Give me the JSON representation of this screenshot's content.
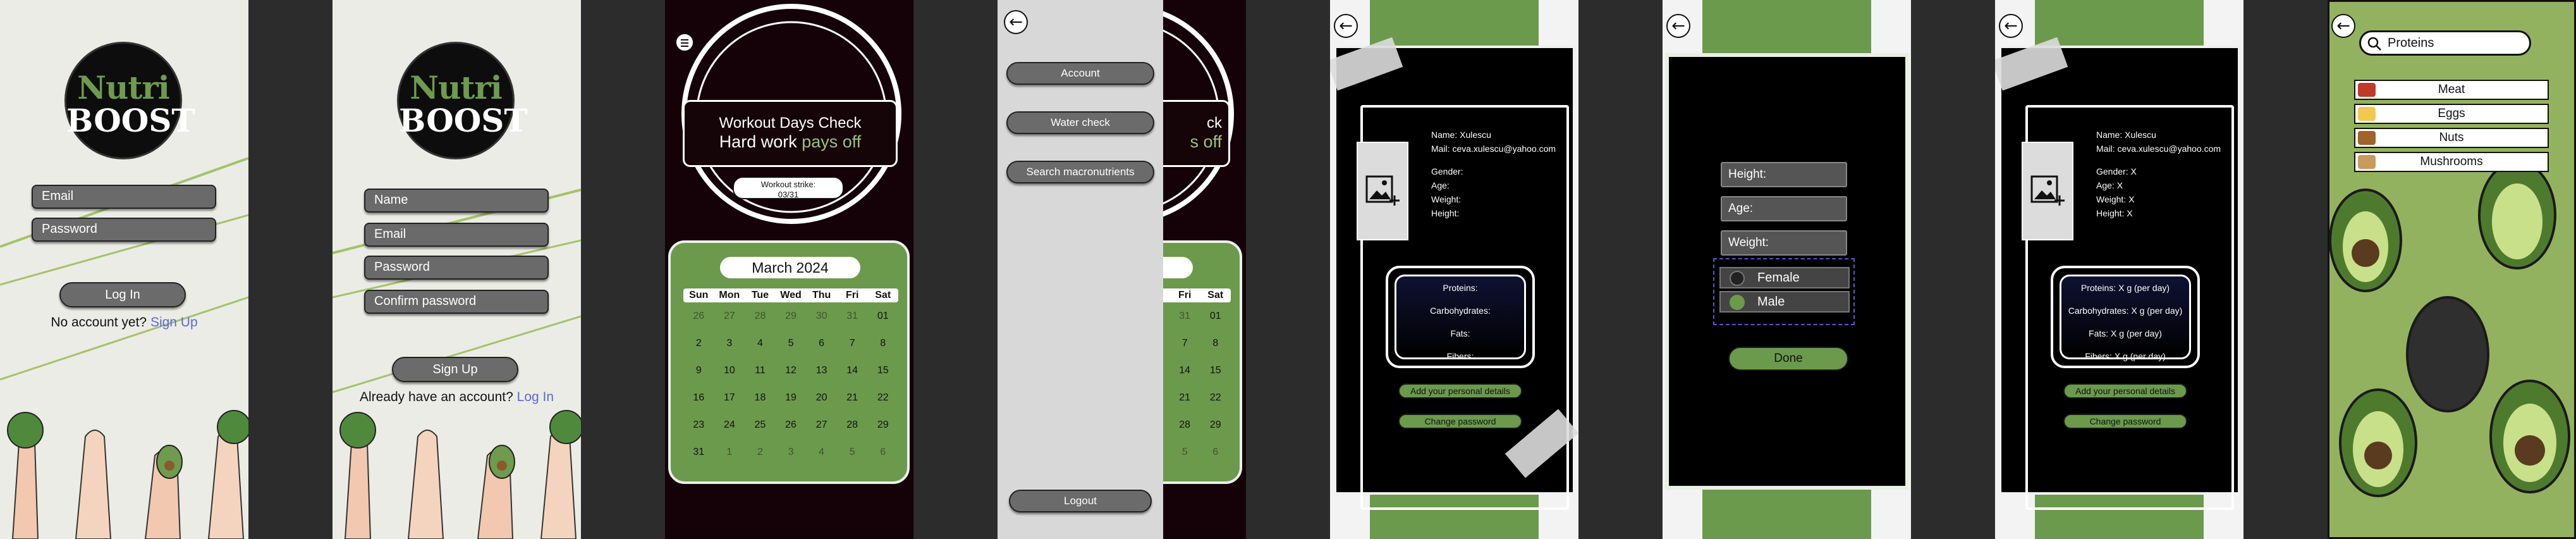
{
  "login": {
    "logo_top": "Nutri",
    "logo_bottom": "BOOST",
    "email_placeholder": "Email",
    "password_placeholder": "Password",
    "login_button": "Log In",
    "no_account": "No account yet?",
    "signup_link": "Sign Up"
  },
  "signup": {
    "logo_top": "Nutri",
    "logo_bottom": "BOOST",
    "name_placeholder": "Name",
    "email_placeholder": "Email",
    "password_placeholder": "Password",
    "confirm_placeholder": "Confirm password",
    "signup_button": "Sign Up",
    "have_account": "Already have an account?",
    "login_link": "Log In"
  },
  "home": {
    "check_title": "Workout Days Check",
    "slogan_a": "Hard work ",
    "slogan_b": "pays off",
    "strike_label": "Workout strike:",
    "strike_value": "03/31",
    "month": "March 2024",
    "weekdays": [
      "Sun",
      "Mon",
      "Tue",
      "Wed",
      "Thu",
      "Fri",
      "Sat"
    ],
    "weeks": [
      [
        "26",
        "27",
        "28",
        "29",
        "30",
        "31",
        "01"
      ],
      [
        "2",
        "3",
        "4",
        "5",
        "6",
        "7",
        "8"
      ],
      [
        "9",
        "10",
        "11",
        "12",
        "13",
        "14",
        "15"
      ],
      [
        "16",
        "17",
        "18",
        "19",
        "20",
        "21",
        "22"
      ],
      [
        "23",
        "24",
        "25",
        "26",
        "27",
        "28",
        "29"
      ],
      [
        "31",
        "1",
        "2",
        "3",
        "4",
        "5",
        "6"
      ]
    ]
  },
  "menu": {
    "items": [
      "Account",
      "Water check",
      "Search macronutrients"
    ],
    "logout": "Logout",
    "check_title_fragment": "ck",
    "slogan_fragment": "s off",
    "weekdays": [
      "Fri",
      "Sat"
    ],
    "weeks": [
      [
        "31",
        "01"
      ],
      [
        "7",
        "8"
      ],
      [
        "14",
        "15"
      ],
      [
        "21",
        "22"
      ],
      [
        "28",
        "29"
      ],
      [
        "5",
        "6"
      ]
    ]
  },
  "profile_empty": {
    "name": "Name: Xulescu",
    "mail": "Mail: ceva.xulescu@yahoo.com",
    "fields": [
      "Gender:",
      "Age:",
      "Weight:",
      "Height:"
    ],
    "macros": [
      "Proteins:",
      "Carbohydrates:",
      "Fats:",
      "Fibers:"
    ],
    "add_details": "Add your personal details",
    "change_password": "Change password"
  },
  "details_form": {
    "height": "Height:",
    "age": "Age:",
    "weight": "Weight:",
    "female": "Female",
    "male": "Male",
    "done": "Done"
  },
  "profile_filled": {
    "name": "Name: Xulescu",
    "mail": "Mail: ceva.xulescu@yahoo.com",
    "fields": [
      "Gender: X",
      "Age: X",
      "Weight: X",
      "Height: X"
    ],
    "macros": [
      "Proteins: X g (per day)",
      "Carbohydrates: X g (per day)",
      "Fats: X g (per day)",
      "Fibers: X g (per day)"
    ],
    "add_details": "Add your personal details",
    "change_password": "Change password"
  },
  "search": {
    "query": "Proteins",
    "results": [
      "Meat",
      "Eggs",
      "Nuts",
      "Mushrooms"
    ],
    "icon_colors": [
      "#c0392b",
      "#f2c94c",
      "#a0632a",
      "#c99a5b"
    ]
  },
  "colors": {
    "accent_green": "#6b9a4c",
    "dark": "#140208",
    "paper": "#ecece6",
    "link": "#5a67d8"
  }
}
